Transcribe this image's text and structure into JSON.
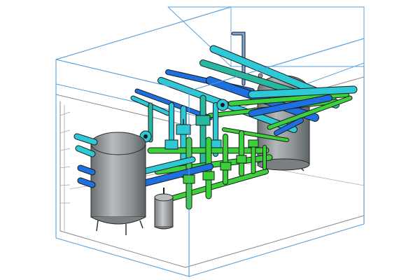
{
  "colors": {
    "background": "#ffffff",
    "enclosure": "#5aa0dc",
    "enclosure_inner": "#7a7a7a",
    "tank_body": "#8f9497",
    "tank_highlight": "#c9ccce",
    "pipe_supply_cyan": "#2ec9d6",
    "pipe_return_blue": "#1e6fe0",
    "pipe_green": "#3ad13a",
    "pipe_teal": "#27b8a0",
    "outline": "#1a1a1a"
  },
  "components": {
    "enclosure": "transparent-equipment-skid-enclosure",
    "left_tank": "large-vertical-storage-tank",
    "right_tank": "large-horizontal-top-storage-tank",
    "expansion_tank": "small-expansion-tank",
    "pump_manifold": "central-pump-and-valve-manifold",
    "vent_pipe": "vertical-vent-pipe"
  },
  "icons": {
    "valve": "gate-valve-icon",
    "pump": "inline-pump-icon"
  }
}
